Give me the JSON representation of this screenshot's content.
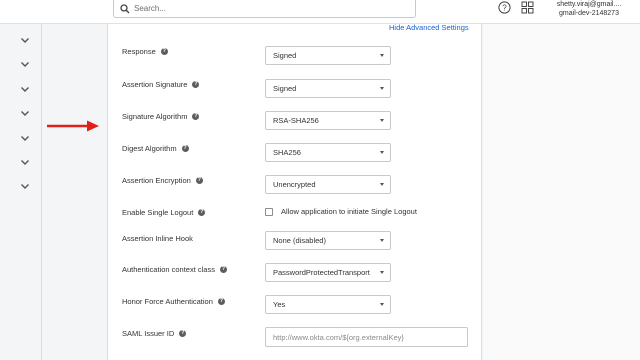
{
  "header": {
    "search_placeholder": "Search...",
    "user_email": "shetty.viraj@gmail....",
    "user_org": "gmail-dev-2148273"
  },
  "settings": {
    "hide_advanced_link": "Hide Advanced Settings",
    "fields": [
      {
        "label": "Response",
        "value": "Signed"
      },
      {
        "label": "Assertion Signature",
        "value": "Signed"
      },
      {
        "label": "Signature Algorithm",
        "value": "RSA-SHA256"
      },
      {
        "label": "Digest Algorithm",
        "value": "SHA256"
      },
      {
        "label": "Assertion Encryption",
        "value": "Unencrypted"
      },
      {
        "label": "Enable Single Logout",
        "checkbox_label": "Allow application to initiate Single Logout"
      },
      {
        "label": "Assertion Inline Hook",
        "value": "None (disabled)"
      },
      {
        "label": "Authentication context class",
        "value": "PasswordProtectedTransport"
      },
      {
        "label": "Honor Force Authentication",
        "value": "Yes"
      },
      {
        "label": "SAML Issuer ID",
        "placeholder": "http://www.okta.com/${org.externalKey}"
      }
    ]
  },
  "colors": {
    "link": "#1662dd",
    "arrow": "#e0201b"
  }
}
